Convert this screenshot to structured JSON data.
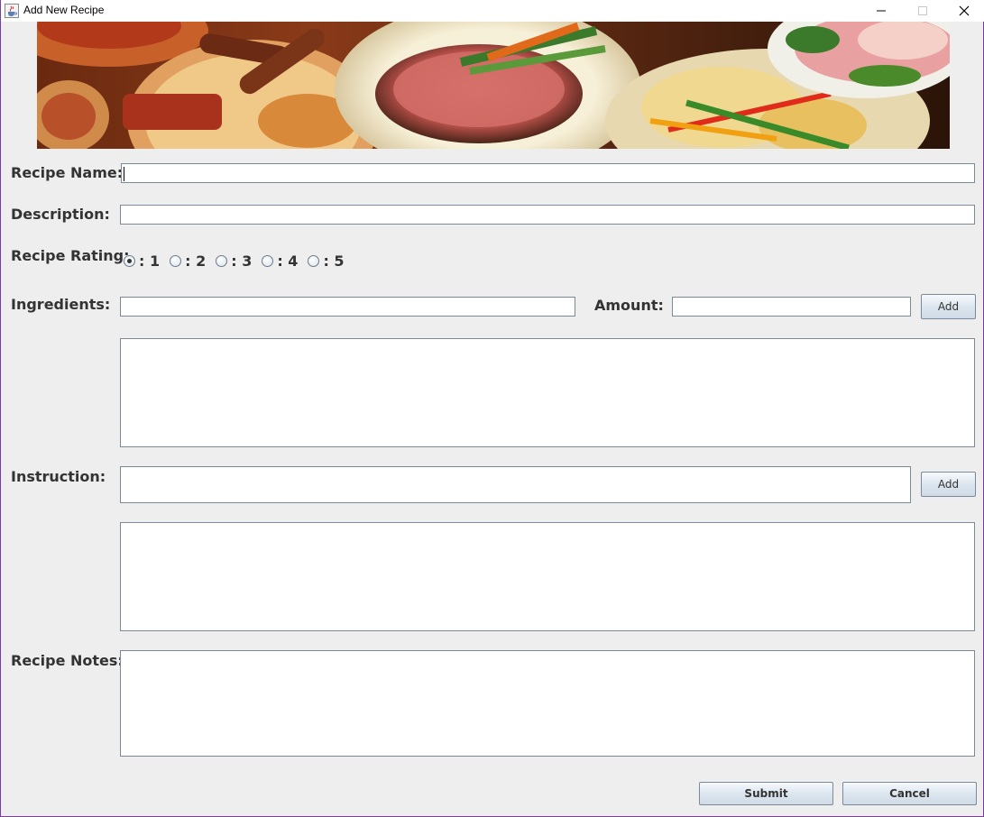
{
  "window": {
    "title": "Add New Recipe",
    "icon": "java-cup-icon"
  },
  "form": {
    "recipe_name_label": "Recipe Name:",
    "recipe_name_value": "",
    "description_label": "Description:",
    "description_value": "",
    "rating_label": "Recipe Rating:",
    "rating_options": [
      ": 1",
      ": 2",
      ": 3",
      ": 4",
      ": 5"
    ],
    "rating_selected": 1,
    "ingredients_label": "Ingredients:",
    "ingredient_value": "",
    "amount_label": "Amount:",
    "amount_value": "",
    "ingredients_add_label": "Add",
    "ingredients_list_value": "",
    "instruction_label": "Instruction:",
    "instruction_value": "",
    "instruction_add_label": "Add",
    "instructions_list_value": "",
    "notes_label": "Recipe Notes:",
    "notes_value": "",
    "submit_label": "Submit",
    "cancel_label": "Cancel"
  },
  "colors": {
    "background": "#eeeeee",
    "label_text": "#333333",
    "field_border": "#7a8a99"
  }
}
